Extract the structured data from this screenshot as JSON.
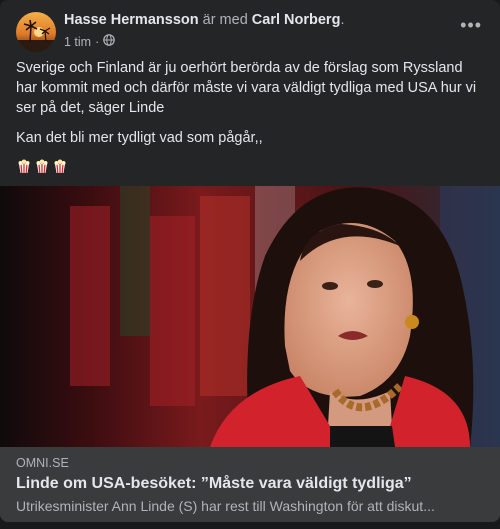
{
  "post": {
    "author": "Hasse Hermansson",
    "with_text": "är med",
    "tagged": "Carl Norberg",
    "tag_suffix": ".",
    "time": "1 tim",
    "time_separator": "·",
    "audience_icon": "globe-icon",
    "more_icon": "more-options-icon",
    "more_symbol": "•••",
    "text_paragraph_1": "Sverige och Finland är ju oerhört berörda av de förslag som Ryssland har kommit med och därför måste vi vara väldigt tydliga med USA hur vi ser på det, säger Linde",
    "text_paragraph_2": "Kan det bli mer tydligt vad som pågår,,",
    "emojis": [
      "popcorn-icon",
      "popcorn-icon",
      "popcorn-icon"
    ]
  },
  "link_preview": {
    "domain": "OMNI.SE",
    "title": "Linde om USA-besöket: ”Måste vara väldigt tydliga”",
    "description": "Utrikesminister Ann Linde (S) har rest till Washington för att diskut..."
  },
  "colors": {
    "background": "#18191a",
    "card": "#242526",
    "link_box": "#3a3b3c",
    "primary_text": "#e4e6eb",
    "secondary_text": "#b0b3b8"
  }
}
